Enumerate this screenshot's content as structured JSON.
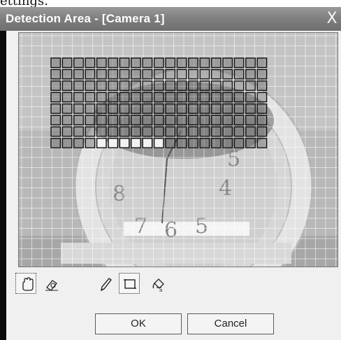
{
  "page_top_text": "ettings.",
  "window": {
    "title": "Detection Area - [Camera 1]",
    "close_label": "X"
  },
  "preview": {
    "clock_numerals": [
      "8",
      "7",
      "6",
      "5",
      "4",
      "5"
    ]
  },
  "toolbar": {
    "tools": [
      {
        "name": "hand-tool",
        "icon": "hand-icon"
      },
      {
        "name": "eraser-tool",
        "icon": "eraser-icon"
      },
      {
        "name": "pencil-tool",
        "icon": "pencil-icon"
      },
      {
        "name": "rectangle-tool",
        "icon": "rectangle-icon"
      },
      {
        "name": "fill-tool",
        "icon": "paint-bucket-icon"
      }
    ]
  },
  "buttons": {
    "ok_label": "OK",
    "cancel_label": "Cancel"
  }
}
